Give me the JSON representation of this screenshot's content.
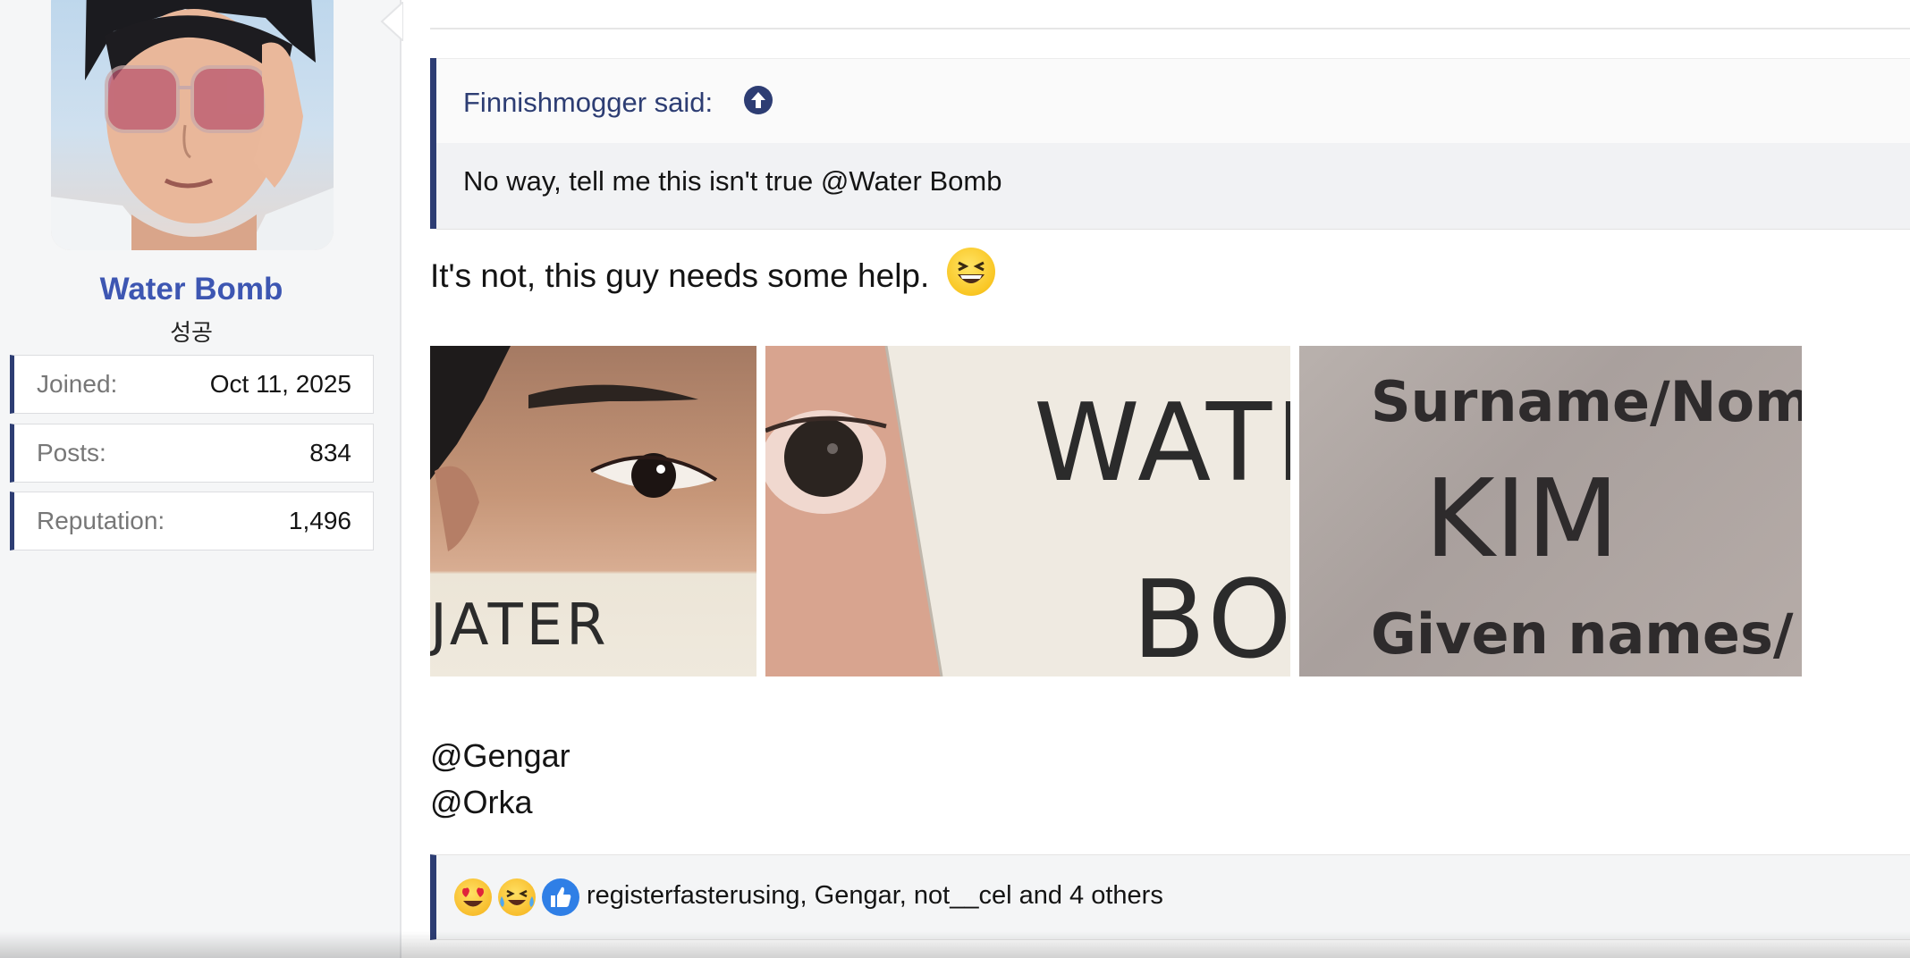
{
  "user": {
    "name": "Water Bomb",
    "title": "성공",
    "stats": [
      {
        "label": "Joined:",
        "value": "Oct 11, 2025"
      },
      {
        "label": "Posts:",
        "value": "834"
      },
      {
        "label": "Reputation:",
        "value": "1,496"
      }
    ]
  },
  "quote": {
    "author": "Finnishmogger said:",
    "text": "No way, tell me this isn't true @Water Bomb"
  },
  "post": {
    "text": "It's not, this guy needs some help.",
    "emoji": "laughing-emoji",
    "mentions": [
      "@Gengar",
      "@Orka"
    ],
    "images": [
      {
        "handwriting": "JATER"
      },
      {
        "handwriting_top": "WATE",
        "handwriting_bottom": "BO"
      },
      {
        "line1": "Surname/Nom",
        "line2": "KIM",
        "line3": "Given names/"
      }
    ]
  },
  "reactions": {
    "icons": [
      "heart-eyes-emoji",
      "crying-laughing-emoji",
      "thumbs-up-icon"
    ],
    "summary": "registerfasterusing, Gengar, not__cel and 4 others"
  },
  "colors": {
    "accent": "#2d3d73",
    "username": "#3d56b2"
  }
}
